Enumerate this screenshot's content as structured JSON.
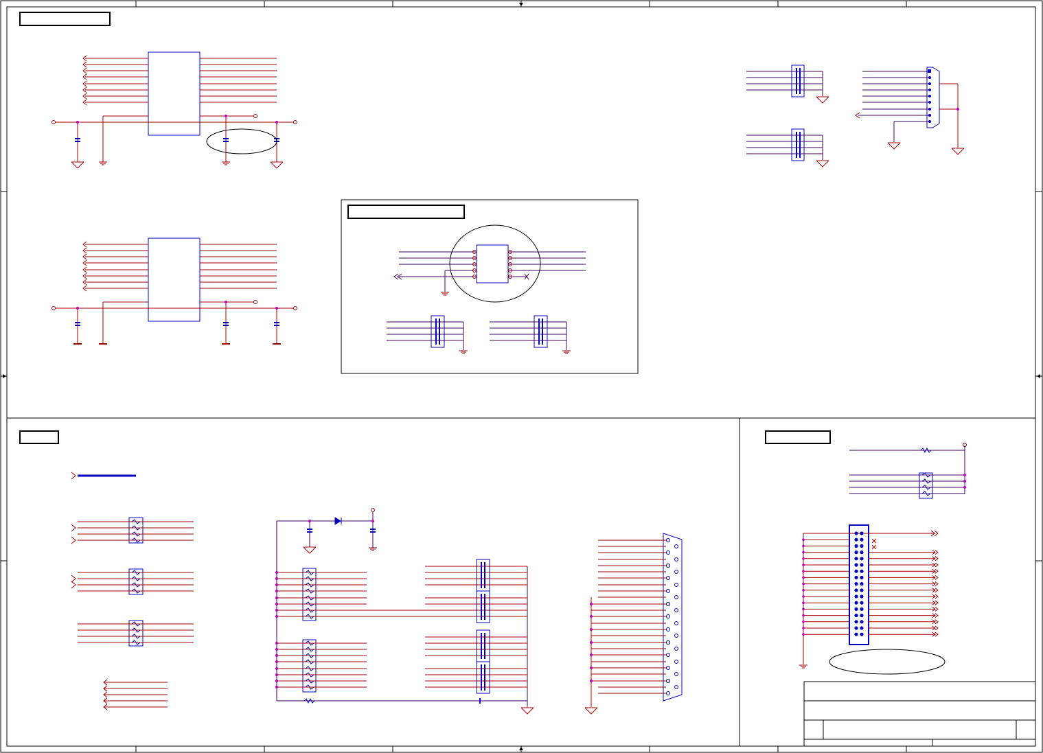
{
  "sheet": {
    "section_labels": [
      "",
      "",
      "",
      "",
      "",
      ""
    ],
    "title_block": [
      "",
      "",
      "",
      "",
      ""
    ]
  },
  "colors": {
    "wire": "#a00000",
    "bus": "#400060",
    "component": "#0000c0",
    "junction": "#c000c0",
    "frame": "#000000"
  },
  "icons": [
    "ground-icon",
    "junction-dot-icon",
    "off-page-connector-icon",
    "capacitor-icon",
    "resistor-pack-icon",
    "diode-icon",
    "db-connector-icon",
    "header-connector-icon",
    "no-connect-icon"
  ]
}
